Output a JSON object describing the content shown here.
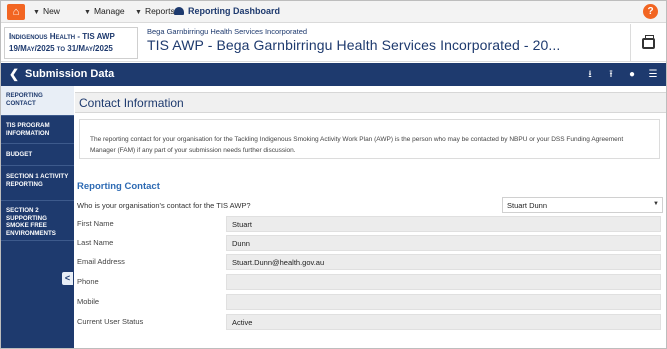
{
  "nav": {
    "new_label": "New",
    "manage_label": "Manage",
    "reports_label": "Reports",
    "dashboard_label": "Reporting Dashboard",
    "help_label": "?"
  },
  "title": {
    "program_name": "Indigenous Health - TIS AWP",
    "program_dates": "19/May/2025 to 31/May/2025",
    "org_subtitle": "Bega Garnbirringu Health Services Incorporated",
    "org_title": "TIS AWP - Bega Garnbirringu Health Services Incorporated - 20..."
  },
  "submission_bar": {
    "back_icon": "chevron-left",
    "title": "Submission Data",
    "icons": [
      "download-icon",
      "upload-icon",
      "comments-icon",
      "menu-icon"
    ]
  },
  "sidebar": {
    "items": [
      {
        "label": "Reporting Contact",
        "active": true
      },
      {
        "label": "TIS Program Information",
        "active": false
      },
      {
        "label": "Budget",
        "active": false
      },
      {
        "label": "Section 1 Activity Reporting",
        "active": false
      },
      {
        "label": "Section 2 Supporting Smoke Free Environments",
        "active": false
      }
    ],
    "collapse_label": "<"
  },
  "main": {
    "section_title": "Contact Information",
    "info_text": "The reporting contact for your organisation for the Tackling Indigenous Smoking Activity Work Plan (AWP) is the person who may be contacted by NBPU or your DSS Funding Agreement Manager (FAM) if any part of your submission needs further discussion.",
    "reporting_contact_heading": "Reporting Contact",
    "question_label": "Who is your organisation's contact for the TIS AWP?",
    "selected_contact": "Stuart Dunn",
    "fields": [
      {
        "label": "First Name",
        "value": "Stuart"
      },
      {
        "label": "Last Name",
        "value": "Dunn"
      },
      {
        "label": "Email Address",
        "value": "Stuart.Dunn@health.gov.au"
      },
      {
        "label": "Phone",
        "value": ""
      },
      {
        "label": "Mobile",
        "value": ""
      },
      {
        "label": "Current User Status",
        "value": "Active"
      }
    ]
  },
  "colors": {
    "brand_navy": "#1e3a6e",
    "accent_orange": "#f26522",
    "heading_blue": "#2d6ab3"
  }
}
